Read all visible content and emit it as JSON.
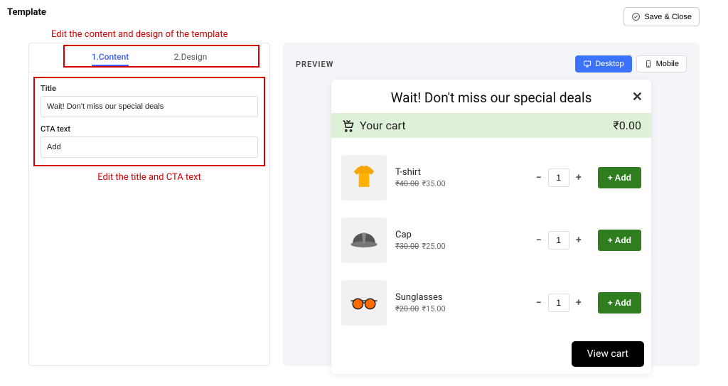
{
  "header": {
    "title": "Template",
    "save_close": "Save & Close"
  },
  "hints": {
    "tabs": "Edit the content and design of the template",
    "form": "Edit the title and CTA text"
  },
  "tabs": {
    "content": "1.Content",
    "design": "2.Design"
  },
  "form": {
    "title_label": "Title",
    "title_value": "Wait! Don't miss our special deals",
    "cta_label": "CTA text",
    "cta_value": "Add"
  },
  "preview": {
    "label": "PREVIEW",
    "desktop": "Desktop",
    "mobile": "Mobile",
    "popup_title": "Wait! Don't miss our special deals",
    "cart_label": "Your cart",
    "cart_total": "₹0.00",
    "view_cart": "View cart",
    "items": [
      {
        "name": "T-shirt",
        "old_price": "₹40.00",
        "new_price": "₹35.00",
        "qty": "1",
        "add_label": "+ Add"
      },
      {
        "name": "Cap",
        "old_price": "₹30.00",
        "new_price": "₹25.00",
        "qty": "1",
        "add_label": "+ Add"
      },
      {
        "name": "Sunglasses",
        "old_price": "₹20.00",
        "new_price": "₹15.00",
        "qty": "1",
        "add_label": "+ Add"
      }
    ]
  }
}
